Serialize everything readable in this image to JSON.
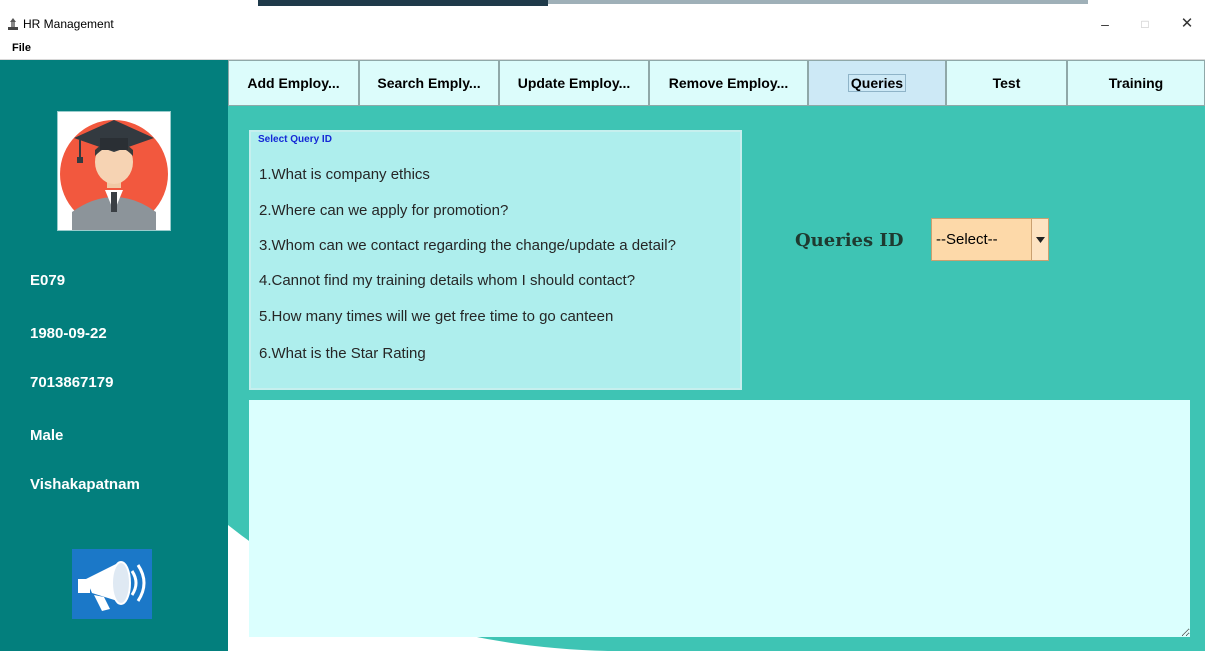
{
  "window": {
    "title": "HR Management",
    "menu": [
      "File"
    ]
  },
  "tabs": [
    {
      "label": "Add Employ...",
      "selected": false
    },
    {
      "label": "Search Emply...",
      "selected": false
    },
    {
      "label": "Update Employ...",
      "selected": false
    },
    {
      "label": "Remove Employ...",
      "selected": false
    },
    {
      "label": "Queries",
      "selected": true
    },
    {
      "label": "Test",
      "selected": false
    },
    {
      "label": "Training",
      "selected": false
    }
  ],
  "profile": {
    "id": "E079",
    "dob": "1980-09-22",
    "phone": "7013867179",
    "gender": "Male",
    "city": "Vishakapatnam"
  },
  "queries_panel": {
    "legend": "Select Query ID",
    "items": [
      "1.What is company ethics",
      "2.Where can we apply for promotion?",
      "3.Whom can we contact regarding the change/update a detail?",
      "4.Cannot find my training details whom I should contact?",
      "5.How many times will we get free time to go canteen",
      "6.What is the Star Rating"
    ]
  },
  "query_id": {
    "label": "Queries ID",
    "selected": "--Select--"
  },
  "answer": {
    "text": ""
  },
  "icons": [
    "app-icon",
    "graduate-avatar-icon",
    "megaphone-icon",
    "chevron-down-icon",
    "minimize-icon",
    "maximize-icon",
    "close-icon"
  ],
  "colors": {
    "sidebar": "#037f7d",
    "main": "#3ec4b4",
    "panel": "#aeeeed",
    "select": "#fdd9a9",
    "answer": "#dbfffe"
  }
}
